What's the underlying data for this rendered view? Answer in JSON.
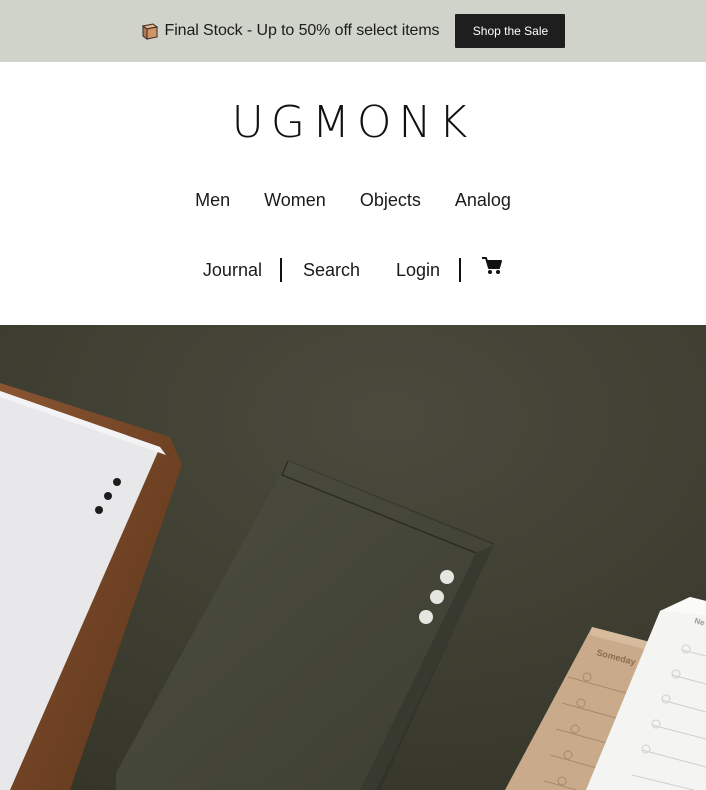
{
  "promo": {
    "icon": "box-icon",
    "text": "Final Stock - Up to 50% off select items",
    "button_label": "Shop the Sale"
  },
  "header": {
    "logo": "UGMONK",
    "main_nav": [
      "Men",
      "Women",
      "Objects",
      "Analog"
    ],
    "util_nav": {
      "journal": "Journal",
      "search": "Search",
      "login": "Login",
      "cart_icon": "shopping-cart-icon"
    }
  },
  "hero": {
    "notepad_label": "Someday",
    "card_label": "Ne",
    "colors": {
      "background": "#3f3f34",
      "card_box": "#45463a",
      "wood": "#7a4a2a",
      "kraft": "#c9ab8c"
    }
  },
  "colors": {
    "promo_bg": "#cfd3ca",
    "button_bg": "#1e1e1e"
  }
}
